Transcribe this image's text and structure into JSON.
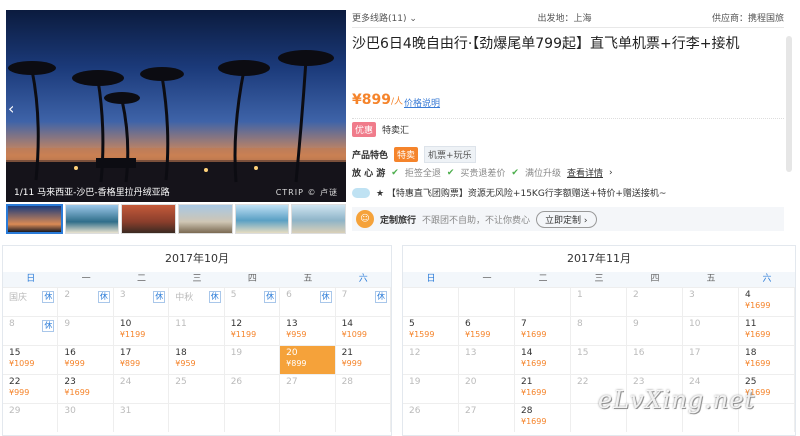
{
  "gallery": {
    "caption": "1/11  马来西亚-沙巴-香格里拉丹绒亚路",
    "watermark": "CTRIP ©  卢谜",
    "prev_icon": "chevron-left-icon"
  },
  "info": {
    "more_routes": "更多线路(11)",
    "departure": "出发地：上海",
    "supplier": "供应商：携程国旅",
    "title": "沙巴6日4晚自由行·【劲爆尾单799起】直飞单机票+行李+接机",
    "price_symbol": "¥",
    "price": "899",
    "price_unit": "/人",
    "price_link": "价格说明",
    "promo_badge": "优惠",
    "promo_text": "特卖汇",
    "feature_label": "产品特色",
    "feature_badge": "特卖",
    "feature_tag": "机票+玩乐",
    "worry_label": "放 心 游",
    "worry_items": [
      "拒签全退",
      "买贵退差价",
      "满位升级"
    ],
    "worry_link": "查看详情",
    "notice": "★ 【特惠直飞团购票】资源无风险+15KG行李额赠送+特价+赠送接机~",
    "custom_label": "定制旅行",
    "custom_text": "不跟团不自助，不让你费心",
    "custom_button": "立即定制"
  },
  "calendar": {
    "weekdays": [
      "日",
      "一",
      "二",
      "三",
      "四",
      "五",
      "六"
    ],
    "months": [
      {
        "title": "2017年10月",
        "cells": [
          {
            "d": "国庆",
            "rest": "休"
          },
          {
            "d": "2",
            "rest": "休"
          },
          {
            "d": "3",
            "rest": "休"
          },
          {
            "d": "中秋",
            "rest": "休"
          },
          {
            "d": "5",
            "rest": "休"
          },
          {
            "d": "6",
            "rest": "休"
          },
          {
            "d": "7",
            "rest": "休"
          },
          {
            "d": "8",
            "rest": "休"
          },
          {
            "d": "9"
          },
          {
            "d": "10",
            "p": "¥1199"
          },
          {
            "d": "11"
          },
          {
            "d": "12",
            "p": "¥1199"
          },
          {
            "d": "13",
            "p": "¥959"
          },
          {
            "d": "14",
            "p": "¥1099"
          },
          {
            "d": "15",
            "p": "¥1099"
          },
          {
            "d": "16",
            "p": "¥999"
          },
          {
            "d": "17",
            "p": "¥899"
          },
          {
            "d": "18",
            "p": "¥959"
          },
          {
            "d": "19"
          },
          {
            "d": "20",
            "p": "¥899",
            "sel": true
          },
          {
            "d": "21",
            "p": "¥999"
          },
          {
            "d": "22",
            "p": "¥999"
          },
          {
            "d": "23",
            "p": "¥1699"
          },
          {
            "d": "24"
          },
          {
            "d": "25"
          },
          {
            "d": "26"
          },
          {
            "d": "27"
          },
          {
            "d": "28"
          },
          {
            "d": "29"
          },
          {
            "d": "30"
          },
          {
            "d": "31"
          },
          {
            "d": ""
          },
          {
            "d": ""
          },
          {
            "d": ""
          },
          {
            "d": ""
          }
        ]
      },
      {
        "title": "2017年11月",
        "cells": [
          {
            "d": ""
          },
          {
            "d": ""
          },
          {
            "d": ""
          },
          {
            "d": "1"
          },
          {
            "d": "2"
          },
          {
            "d": "3"
          },
          {
            "d": "4",
            "p": "¥1699"
          },
          {
            "d": "5",
            "p": "¥1599"
          },
          {
            "d": "6",
            "p": "¥1599"
          },
          {
            "d": "7",
            "p": "¥1699"
          },
          {
            "d": "8"
          },
          {
            "d": "9"
          },
          {
            "d": "10"
          },
          {
            "d": "11",
            "p": "¥1699"
          },
          {
            "d": "12"
          },
          {
            "d": "13"
          },
          {
            "d": "14",
            "p": "¥1699"
          },
          {
            "d": "15"
          },
          {
            "d": "16"
          },
          {
            "d": "17"
          },
          {
            "d": "18",
            "p": "¥1699"
          },
          {
            "d": "19"
          },
          {
            "d": "20"
          },
          {
            "d": "21",
            "p": "¥1699"
          },
          {
            "d": "22"
          },
          {
            "d": "23"
          },
          {
            "d": "24"
          },
          {
            "d": "25",
            "p": "¥1699"
          },
          {
            "d": "26"
          },
          {
            "d": "27"
          },
          {
            "d": "28",
            "p": "¥1699"
          },
          {
            "d": ""
          },
          {
            "d": ""
          },
          {
            "d": ""
          },
          {
            "d": ""
          }
        ]
      }
    ]
  },
  "watermark_text": "eLvXing.net",
  "colors": {
    "accent": "#f5842b",
    "selected": "#f5a23a",
    "link": "#2a7bd8"
  }
}
